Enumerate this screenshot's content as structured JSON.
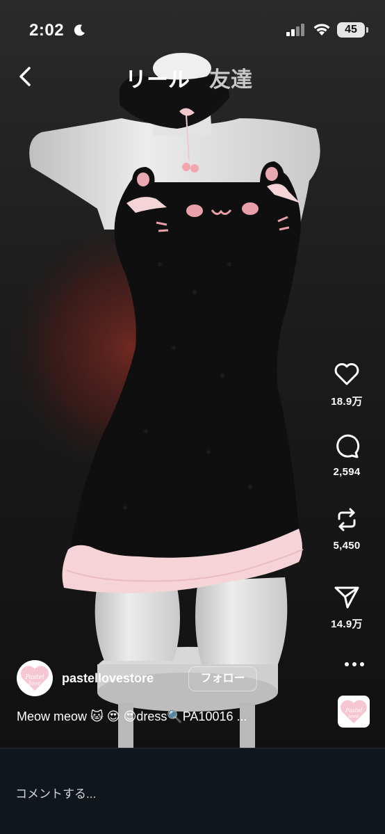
{
  "status_bar": {
    "time": "2:02",
    "battery": "45"
  },
  "nav": {
    "tabs": [
      {
        "label": "リール"
      },
      {
        "label": "友達"
      }
    ]
  },
  "actions": {
    "like_count": "18.9万",
    "comment_count": "2,594",
    "repost_count": "5,450",
    "share_count": "14.9万"
  },
  "post": {
    "username": "pastellovestore",
    "follow_label": "フォロー",
    "caption": "Meow meow 🐱 😍 😍dress🔍PA10016 ...",
    "avatar_text": "Pastel love"
  },
  "comment_bar": {
    "placeholder": "コメントする..."
  },
  "colors": {
    "background": "#1b1b1b",
    "dress": "#0f0f0f",
    "ruffle": "#f5d3d6",
    "mannequin": "#dcdcdc",
    "comment_bar": "#10161c"
  }
}
